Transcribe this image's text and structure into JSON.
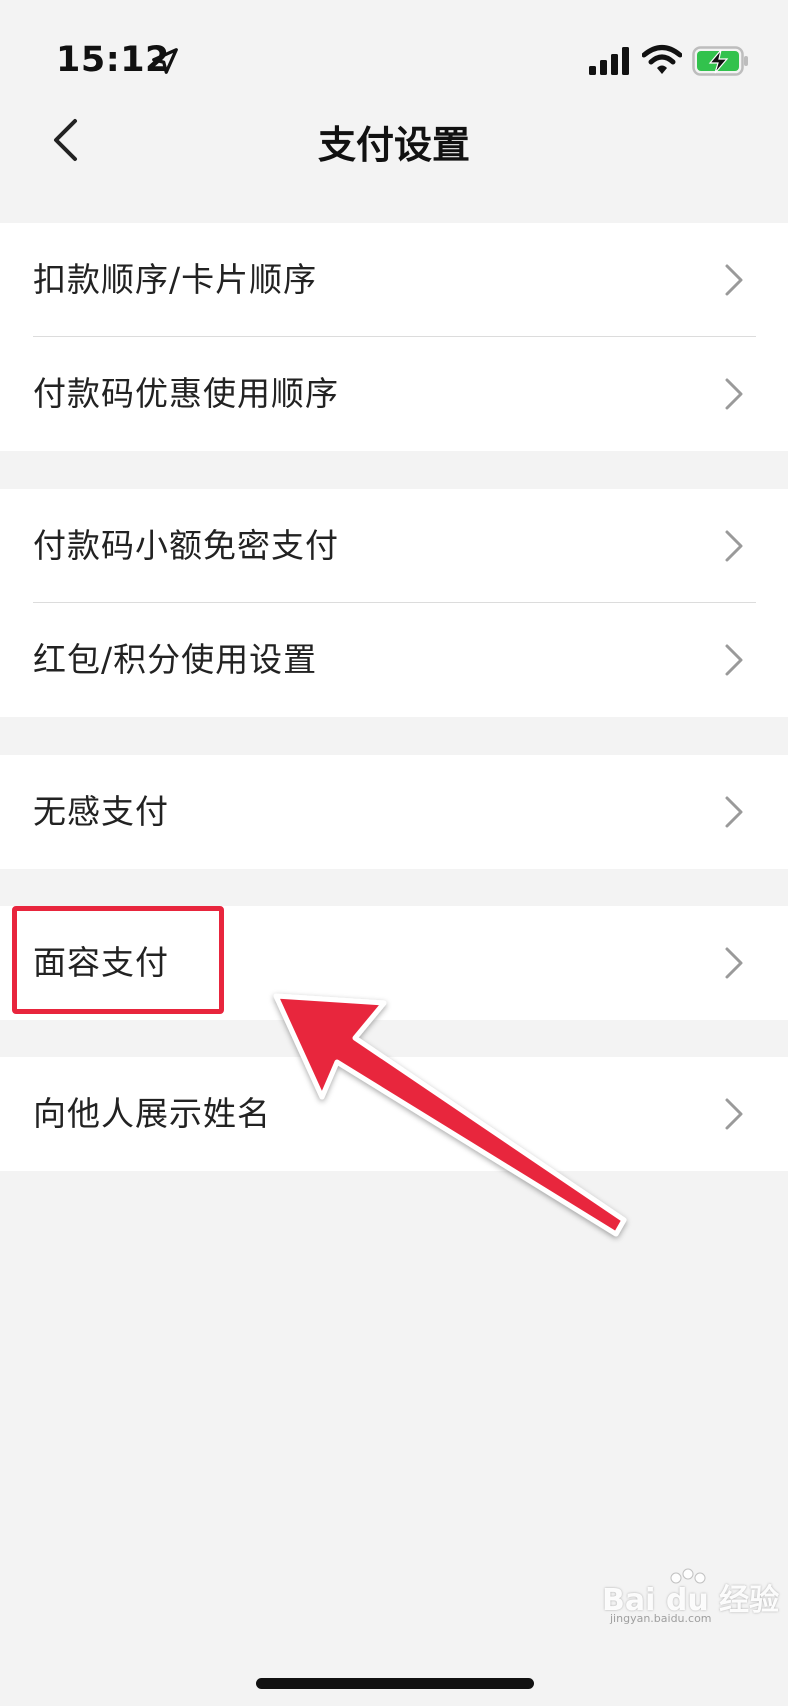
{
  "status_bar": {
    "time": "15:12",
    "icons": [
      "location-arrow-icon",
      "cellular-signal-icon",
      "wifi-icon",
      "battery-charging-icon"
    ],
    "battery_color": "#32c24d"
  },
  "nav": {
    "back_icon": "chevron-left-icon",
    "title": "支付设置"
  },
  "groups": [
    {
      "items": [
        {
          "label": "扣款顺序/卡片顺序"
        },
        {
          "label": "付款码优惠使用顺序"
        }
      ]
    },
    {
      "items": [
        {
          "label": "付款码小额免密支付"
        },
        {
          "label": "红包/积分使用设置"
        }
      ]
    },
    {
      "items": [
        {
          "label": "无感支付"
        }
      ]
    },
    {
      "items": [
        {
          "label": "面容支付"
        }
      ]
    },
    {
      "items": [
        {
          "label": "向他人展示姓名"
        }
      ]
    }
  ],
  "annotation": {
    "highlight_color": "#e8253d",
    "highlighted_item": "面容支付"
  },
  "watermark": {
    "text": "Bai du 经验",
    "sub": "jingyan.baidu.com"
  },
  "colors": {
    "background": "#f3f3f3",
    "card": "#ffffff",
    "text": "#222222",
    "chevron": "#9a9a9a"
  }
}
